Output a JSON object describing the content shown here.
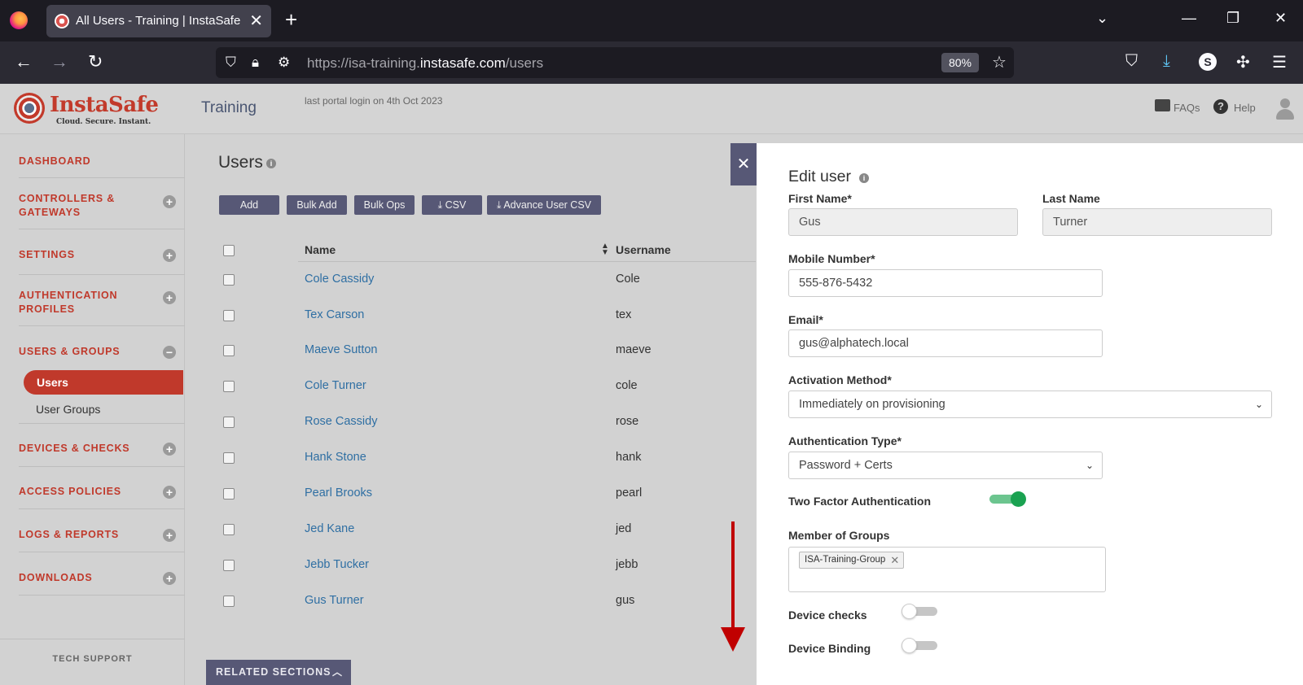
{
  "browser": {
    "tab_title": "All Users - Training | InstaSafe",
    "url_prefix": "https://isa-training.",
    "url_domain": "instasafe.com",
    "url_path": "/users",
    "zoom": "80%",
    "profile_initial": "S"
  },
  "header": {
    "logo_name": "InstaSafe",
    "logo_tagline": "Cloud. Secure. Instant.",
    "app_title": "Training",
    "last_login": "last portal login on 4th Oct 2023",
    "faqs": "FAQs",
    "help": "Help"
  },
  "sidebar": {
    "items": [
      {
        "label": "DASHBOARD"
      },
      {
        "label": "CONTROLLERS & GATEWAYS"
      },
      {
        "label": "SETTINGS"
      },
      {
        "label": "AUTHENTICATION PROFILES"
      },
      {
        "label": "USERS & GROUPS"
      },
      {
        "label": "DEVICES & CHECKS"
      },
      {
        "label": "ACCESS POLICIES"
      },
      {
        "label": "LOGS & REPORTS"
      },
      {
        "label": "DOWNLOADS"
      }
    ],
    "sub_active": "Users",
    "sub_other": "User Groups",
    "tech_support": "TECH SUPPORT"
  },
  "users": {
    "title": "Users",
    "buttons": [
      "Add",
      "Bulk Add",
      "Bulk Ops",
      "CSV",
      "Advance User CSV"
    ],
    "columns": [
      "Name",
      "Username"
    ],
    "rows": [
      {
        "name": "Cole Cassidy",
        "username": "Cole"
      },
      {
        "name": "Tex Carson",
        "username": "tex"
      },
      {
        "name": "Maeve Sutton",
        "username": "maeve"
      },
      {
        "name": "Cole Turner",
        "username": "cole"
      },
      {
        "name": "Rose Cassidy",
        "username": "rose"
      },
      {
        "name": "Hank Stone",
        "username": "hank"
      },
      {
        "name": "Pearl Brooks",
        "username": "pearl"
      },
      {
        "name": "Jed Kane",
        "username": "jed"
      },
      {
        "name": "Jebb Tucker",
        "username": "jebb"
      },
      {
        "name": "Gus Turner",
        "username": "gus"
      }
    ],
    "related_sections": "RELATED SECTIONS"
  },
  "edit_user": {
    "title": "Edit user",
    "first_name_label": "First Name*",
    "first_name": "Gus",
    "last_name_label": "Last Name",
    "last_name": "Turner",
    "mobile_label": "Mobile Number*",
    "mobile": "555-876-5432",
    "email_label": "Email*",
    "email": "gus@alphatech.local",
    "activation_label": "Activation Method*",
    "activation": "Immediately on provisioning",
    "auth_type_label": "Authentication Type*",
    "auth_type": "Password + Certs",
    "two_factor_label": "Two Factor Authentication",
    "two_factor_on": true,
    "groups_label": "Member of Groups",
    "groups": [
      "ISA-Training-Group"
    ],
    "device_checks_label": "Device checks",
    "device_checks_on": false,
    "device_binding_label": "Device Binding",
    "device_binding_on": false
  }
}
